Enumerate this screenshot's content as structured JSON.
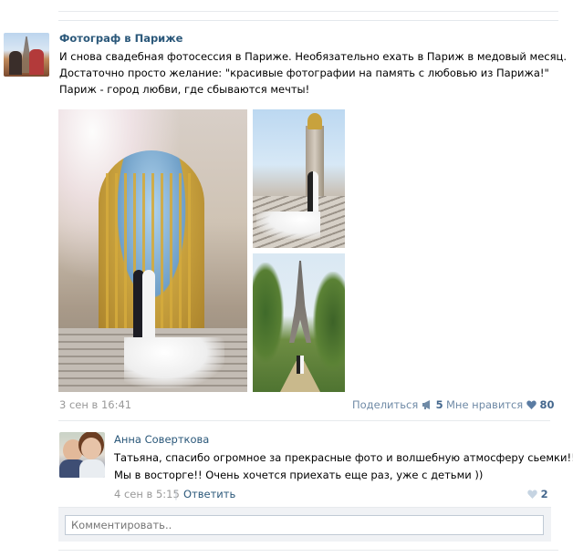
{
  "post": {
    "author": "Фотограф в Париже",
    "text_lines": [
      "И снова свадебная фотосессия в Париже. Необязательно ехать в Париж в медовый месяц.",
      "Достаточно просто желание: \"красивые фотографии на память с любовью из Парижа!\"",
      "Париж - город любви, где сбываются мечты!"
    ],
    "date": "3 сен в 16:41",
    "share_label": "Поделиться",
    "share_count": "5",
    "like_label": "Мне нравится",
    "like_count": "80",
    "photos": [
      "wedding-palace-gate-photo",
      "wedding-bridge-stairs-photo",
      "wedding-eiffel-tower-photo"
    ]
  },
  "comment": {
    "author": "Анна Соверткова",
    "text_lines": [
      "Татьяна, спасибо огромное за прекрасные фото и волшебную атмосферу сьемки!!!",
      "Мы в восторге!! Очень хочется приехать еще раз, уже с детьми ))"
    ],
    "date": "4 сен в 5:15",
    "separator": "|",
    "reply_label": "Ответить",
    "like_count": "2"
  },
  "comment_input": {
    "placeholder": "Комментировать.."
  },
  "colors": {
    "link": "#2b587a",
    "meta": "#999999",
    "action": "#6f8aa6",
    "action_count": "#45688e"
  }
}
